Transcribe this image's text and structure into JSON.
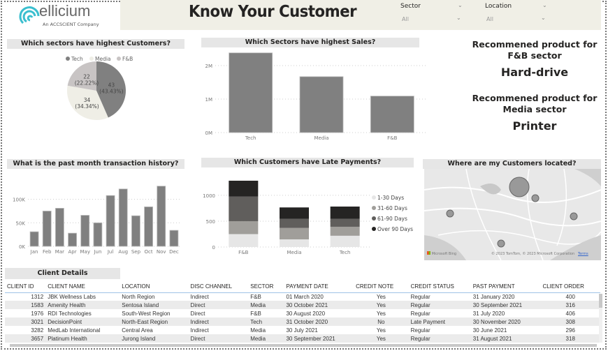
{
  "logo": {
    "brand": "ellicium",
    "tagline": "An ACCSCIENT Company"
  },
  "header": {
    "title": "Know Your Customer"
  },
  "filters": [
    {
      "label": "Sector",
      "value": "All"
    },
    {
      "label": "Location",
      "value": "All"
    }
  ],
  "colors": {
    "header_bg": "#f0efe6",
    "bar": "#808080",
    "tech": "#808080",
    "media": "#efeee6",
    "fnb": "#c8c4c4",
    "d1_30": "#e6e6e6",
    "d31_60": "#a09e9a",
    "d61_90": "#605e5c",
    "d90": "#252423"
  },
  "recommendations": [
    {
      "question": "Recommened product for F&B sector",
      "answer": "Hard-drive"
    },
    {
      "question": "Recommened product for Media sector",
      "answer": "Printer"
    }
  ],
  "map": {
    "title": "Where are my Customers located?",
    "attribution": "© 2023 TomTom, © 2023 Microsoft Corporation",
    "terms": "Terms",
    "provider": "Microsoft Bing"
  },
  "chart_data": [
    {
      "type": "pie",
      "title": "Which sectors have highest Customers?",
      "legend": [
        "Tech",
        "Media",
        "F&B"
      ],
      "legend_position": "top",
      "values": [
        43,
        34,
        22
      ],
      "labels": [
        "43\n(43.43%)",
        "34\n(34.34%)",
        "22\n(22.22%)"
      ]
    },
    {
      "type": "bar",
      "title": "Which Sectors have highest Sales?",
      "categories": [
        "Tech",
        "Media",
        "F&B"
      ],
      "values": [
        2380000,
        1670000,
        1090000
      ],
      "yticks": [
        "0M",
        "1M",
        "2M"
      ],
      "ylim": [
        0,
        2500000
      ],
      "grid": true
    },
    {
      "type": "bar",
      "title": "What is the past month transaction history?",
      "categories": [
        "Jan",
        "Feb",
        "Mar",
        "Apr",
        "May",
        "Jun",
        "Jul",
        "Aug",
        "Sep",
        "Oct",
        "Nov",
        "Dec"
      ],
      "values": [
        31000,
        75000,
        81000,
        28000,
        66000,
        50000,
        108000,
        122000,
        65000,
        84000,
        128000,
        34000
      ],
      "yticks": [
        "0K",
        "50K",
        "100K"
      ],
      "ylim": [
        0,
        135000
      ],
      "grid": true
    },
    {
      "type": "bar",
      "stacked": true,
      "title": "Which Customers have Late Payments?",
      "categories": [
        "F&B",
        "Media",
        "Tech"
      ],
      "series": [
        {
          "name": "1-30 Days",
          "values": [
            250,
            148,
            218
          ]
        },
        {
          "name": "31-60 Days",
          "values": [
            250,
            222,
            174
          ]
        },
        {
          "name": "61-90 Days",
          "values": [
            475,
            174,
            152
          ]
        },
        {
          "name": "Over 90 Days",
          "values": [
            308,
            222,
            239
          ]
        }
      ],
      "yticks": [
        "0",
        "500",
        "1000"
      ],
      "ylim": [
        0,
        1350
      ],
      "legend_position": "right",
      "grid": true
    }
  ],
  "table": {
    "title": "Client Details",
    "columns": [
      "CLIENT ID",
      "CLIENT NAME",
      "LOCATION",
      "DISC CHANNEL",
      "SECTOR",
      "PAYMENT DATE",
      "CREDIT NOTE",
      "CREDIT STATUS",
      "PAST PAYMENT",
      "CLIENT ORDER"
    ],
    "rows": [
      [
        "1312",
        "JBK Wellness Labs",
        "North Region",
        "Indirect",
        "F&B",
        "01 March 2020",
        "Yes",
        "Regular",
        "31 January 2020",
        "400"
      ],
      [
        "1583",
        "Amenity Health",
        "Sentosa Island",
        "Direct",
        "Media",
        "30 October 2021",
        "Yes",
        "Regular",
        "30 September 2021",
        "316"
      ],
      [
        "1976",
        "RDI Technologies",
        "South-West Region",
        "Direct",
        "F&B",
        "30 August 2020",
        "Yes",
        "Regular",
        "31 July 2020",
        "406"
      ],
      [
        "3021",
        "DecisionPoint",
        "North-East Region",
        "Indirect",
        "Tech",
        "31 October 2020",
        "No",
        "Late Payment",
        "30 November 2020",
        "308"
      ],
      [
        "3282",
        "MedLab International",
        "Central Area",
        "Indirect",
        "Media",
        "30 July 2021",
        "Yes",
        "Regular",
        "30 June 2021",
        "296"
      ],
      [
        "3657",
        "Platinum Health",
        "Jurong Island",
        "Direct",
        "Media",
        "30 September 2021",
        "Yes",
        "Regular",
        "31 August 2021",
        "318"
      ]
    ]
  }
}
